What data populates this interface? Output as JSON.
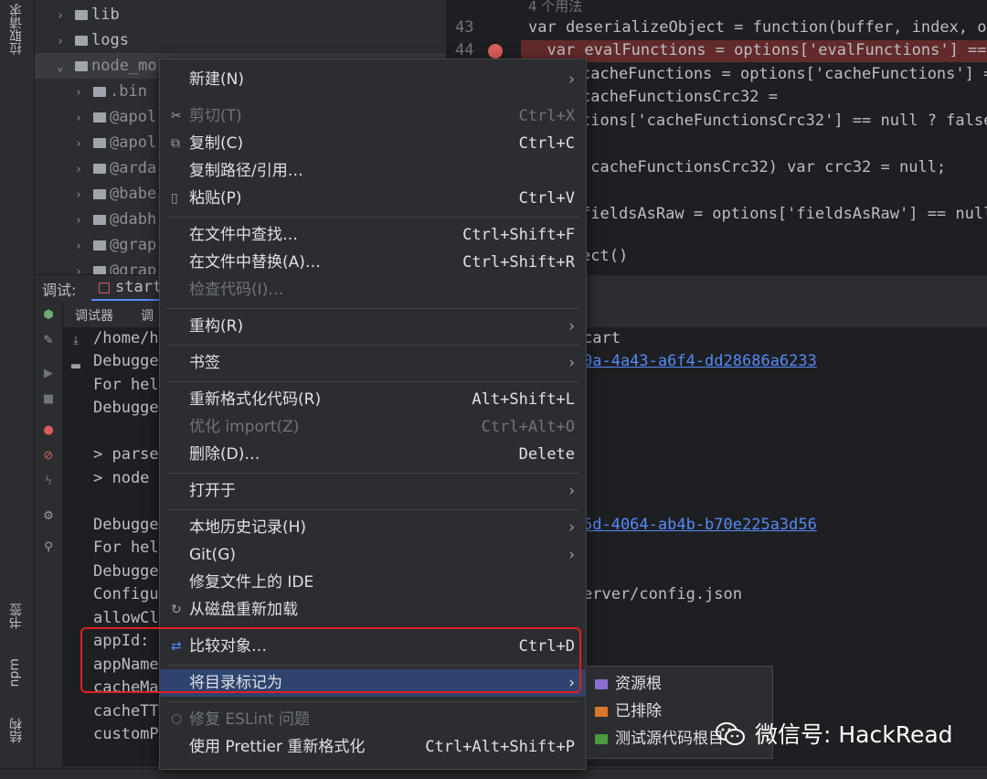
{
  "tool_strip": {
    "top_tab": "拉取请求",
    "bookmarks_tab": "书签",
    "npm_tab": "npm",
    "structure_tab": "结构"
  },
  "project_tree": {
    "rows": [
      {
        "label": "lib"
      },
      {
        "label": "logs"
      },
      {
        "label": "node_mo"
      },
      {
        "label": ".bin"
      },
      {
        "label": "@apol"
      },
      {
        "label": "@apol"
      },
      {
        "label": "@arda"
      },
      {
        "label": "@babe"
      },
      {
        "label": "@dabh"
      },
      {
        "label": "@grap"
      },
      {
        "label": "@grap"
      }
    ]
  },
  "editor": {
    "usage_hint": "4 个用法",
    "line_numbers": [
      "43",
      "44"
    ],
    "lines": [
      "var deserializeObject = function(buffer, index, opt",
      "  var evalFunctions = options['evalFunctions'] == n",
      "cacheFunctions = options['cacheFunctions'] ==",
      "cacheFunctionsCrc32 =",
      "tions['cacheFunctionsCrc32'] == null ? false",
      "!cacheFunctionsCrc32) var crc32 = null;",
      "fieldsAsRaw = options['fieldsAsRaw'] == null",
      "ect()"
    ]
  },
  "debug_panel": {
    "label": "调试:",
    "tab": "start",
    "sub_tabs": [
      "调试器",
      "调"
    ]
  },
  "console": {
    "lines": [
      "/home/h",
      "Debugge",
      "For hel",
      "Debugge",
      "",
      "> parse",
      "> node",
      "",
      "Debugge",
      "For hel",
      "Debugge",
      "Configu",
      "allowCl",
      "appId:",
      "appName",
      "cacheMa",
      "cacheTT",
      "customP"
    ],
    "right_texts": {
      "start": "cart",
      "link1": "0a-4a43-a6f4-dd28686a6233",
      "link2": "5d-4064-ab4b-b70e225a3d56",
      "config": "erver/config.json"
    }
  },
  "context_menu": {
    "items": [
      {
        "label": "新建(N)",
        "shortcut": "",
        "submenu": true
      },
      {
        "label": "剪切(T)",
        "shortcut": "Ctrl+X",
        "icon": "scissors-icon",
        "disabled": true
      },
      {
        "label": "复制(C)",
        "shortcut": "Ctrl+C",
        "icon": "copy-icon"
      },
      {
        "label": "复制路径/引用…",
        "shortcut": ""
      },
      {
        "label": "粘贴(P)",
        "shortcut": "Ctrl+V",
        "icon": "paste-icon"
      },
      {
        "label": "在文件中查找…",
        "shortcut": "Ctrl+Shift+F"
      },
      {
        "label": "在文件中替换(A)…",
        "shortcut": "Ctrl+Shift+R"
      },
      {
        "label": "检查代码(I)…",
        "shortcut": "",
        "disabled": true
      },
      {
        "label": "重构(R)",
        "shortcut": "",
        "submenu": true
      },
      {
        "label": "书签",
        "shortcut": "",
        "submenu": true
      },
      {
        "label": "重新格式化代码(R)",
        "shortcut": "Alt+Shift+L"
      },
      {
        "label": "优化 import(Z)",
        "shortcut": "Ctrl+Alt+O",
        "disabled": true
      },
      {
        "label": "删除(D)…",
        "shortcut": "Delete"
      },
      {
        "label": "打开于",
        "shortcut": "",
        "submenu": true
      },
      {
        "label": "本地历史记录(H)",
        "shortcut": "",
        "submenu": true
      },
      {
        "label": "Git(G)",
        "shortcut": "",
        "submenu": true
      },
      {
        "label": "修复文件上的 IDE",
        "shortcut": ""
      },
      {
        "label": "从磁盘重新加载",
        "shortcut": "",
        "icon": "reload-icon"
      },
      {
        "label": "比较对象…",
        "shortcut": "Ctrl+D",
        "icon": "compare-icon"
      },
      {
        "label": "将目录标记为",
        "shortcut": "",
        "submenu": true
      },
      {
        "label": "修复 ESLint 问题",
        "shortcut": "",
        "icon": "eslint-icon",
        "disabled": true
      },
      {
        "label": "使用 Prettier 重新格式化",
        "shortcut": "Ctrl+Alt+Shift+P"
      }
    ]
  },
  "submenu": {
    "items": [
      {
        "label": "资源根",
        "color": "#8a6fd1"
      },
      {
        "label": "已排除",
        "color": "#d9782b"
      },
      {
        "label": "测试源代码根目",
        "color": "#4e9a3e"
      }
    ]
  },
  "watermark": {
    "text": "微信号: HackRead"
  },
  "colors": {
    "accent_highlight": "#2e436e",
    "breakpoint": "#db5c5c",
    "red_box": "#e0201f"
  }
}
